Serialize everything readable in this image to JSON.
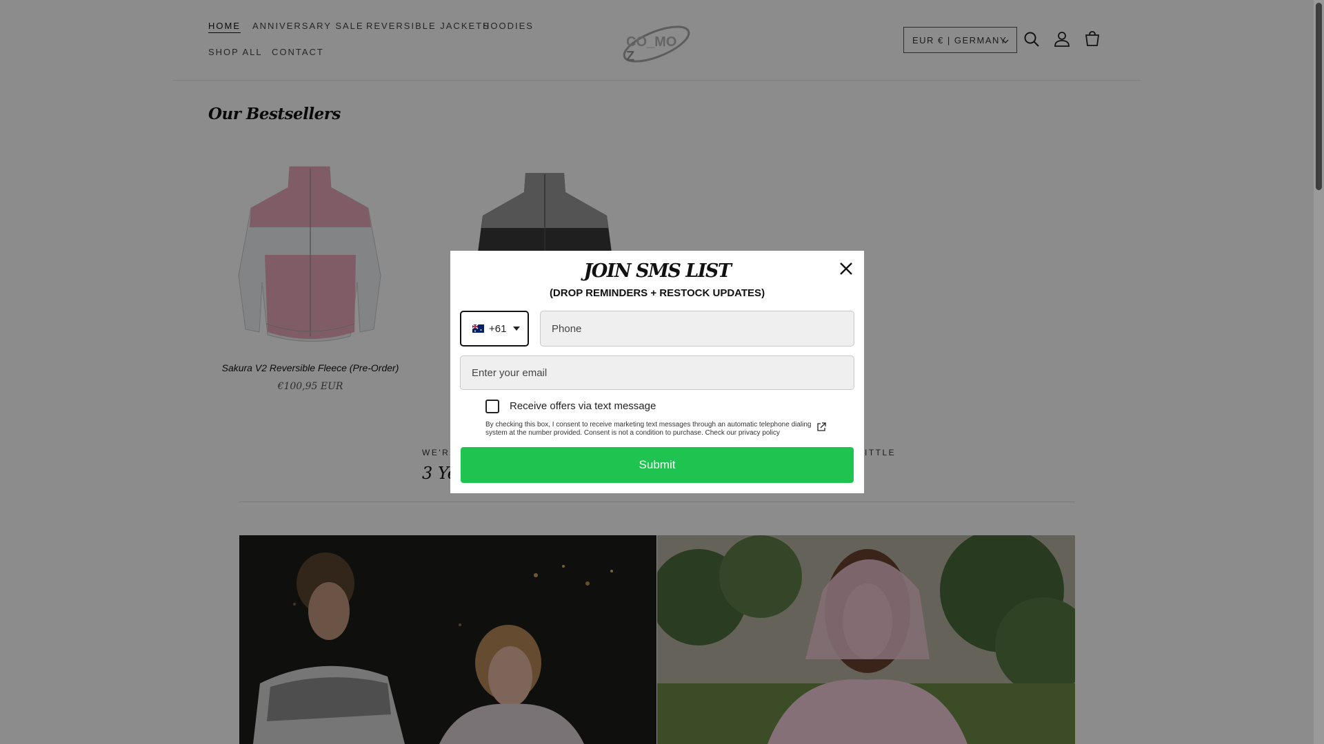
{
  "nav": {
    "items": [
      "HOME",
      "ANNIVERSARY SALE",
      "REVERSIBLE JACKETS",
      "HOODIES",
      "SHOP ALL",
      "CONTACT"
    ]
  },
  "header": {
    "logo_text": "CO_MO",
    "currency": "EUR € | GERMANY",
    "icons": [
      "search-icon",
      "account-icon",
      "cart-icon"
    ]
  },
  "bestsellers": {
    "title": "Our Bestsellers",
    "products": [
      {
        "name": "Sakura V2 Reversible Fleece (Pre-Order)",
        "price": "€100,95 EUR"
      }
    ]
  },
  "feature": {
    "eyebrow_left": "WE'RE",
    "eyebrow_right": "ITTLE",
    "heading": "3 Yea"
  },
  "modal": {
    "title": "JOIN SMS LIST",
    "subtitle": "(DROP REMINDERS + RESTOCK UPDATES)",
    "country_code": "+61",
    "phone_placeholder": "Phone",
    "email_placeholder": "Enter your email",
    "checkbox_label": "Receive offers via text message",
    "consent_text": "By checking this box, I consent to receive marketing text messages through an automatic telephone dialing system at the number provided. Consent is not a condition to purchase. Check our privacy policy",
    "submit_label": "Submit"
  },
  "colors": {
    "submit": "#1fc34f",
    "overlay": "rgba(0,0,0,0.45)",
    "jacket_pink": "#e9a9bb",
    "jacket_white": "#eef0f2"
  }
}
